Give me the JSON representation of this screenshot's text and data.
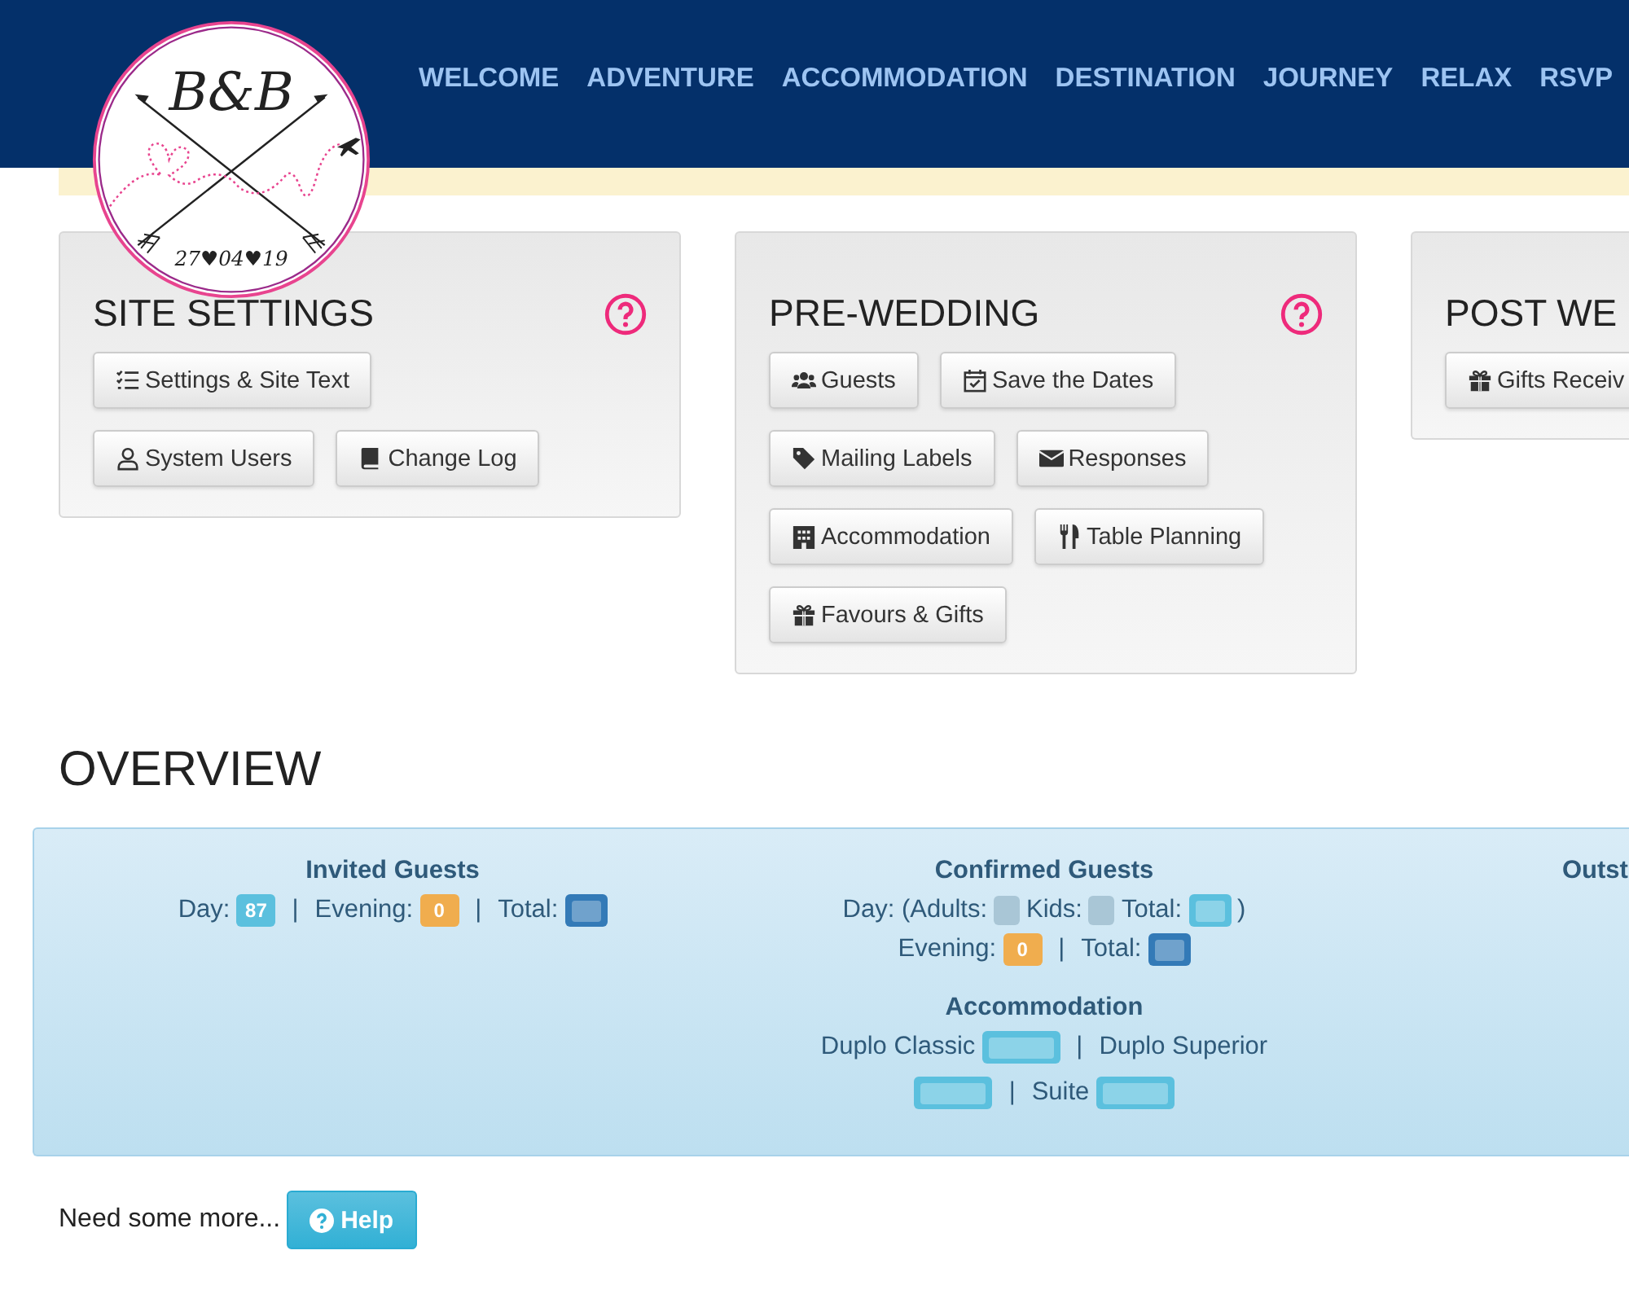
{
  "logo": {
    "monogram": "B&B",
    "date": "27♥04♥19"
  },
  "nav": [
    "WELCOME",
    "ADVENTURE",
    "ACCOMMODATION",
    "DESTINATION",
    "JOURNEY",
    "RELAX",
    "RSVP"
  ],
  "cards": [
    {
      "title": "SITE SETTINGS",
      "buttons": [
        "Settings & Site Text",
        "System Users",
        "Change Log"
      ]
    },
    {
      "title": "PRE-WEDDING",
      "buttons": [
        "Guests",
        "Save the Dates",
        "Mailing Labels",
        "Responses",
        "Accommodation",
        "Table Planning",
        "Favours & Gifts"
      ]
    },
    {
      "title": "POST WE",
      "buttons": [
        "Gifts Receiv"
      ]
    }
  ],
  "overview": {
    "title": "OVERVIEW",
    "columns": [
      {
        "sections": [
          {
            "title": "Invited Guests",
            "lines": [
              [
                {
                  "kind": "text",
                  "text": "Day:"
                },
                {
                  "kind": "badge",
                  "color": "#5bc0de",
                  "value": "87"
                },
                {
                  "kind": "sep",
                  "text": "|"
                },
                {
                  "kind": "text",
                  "text": "Evening:"
                },
                {
                  "kind": "badge",
                  "color": "#f0ad4e",
                  "value": "0"
                },
                {
                  "kind": "sep",
                  "text": "|"
                },
                {
                  "kind": "text",
                  "text": "Total:"
                },
                {
                  "kind": "badge",
                  "color": "#337ab7",
                  "redacted": true
                }
              ]
            ]
          }
        ]
      },
      {
        "sections": [
          {
            "title": "Confirmed Guests",
            "lines": [
              [
                {
                  "kind": "text",
                  "text": "Day: (Adults:"
                },
                {
                  "kind": "smudge"
                },
                {
                  "kind": "text",
                  "text": "Kids:"
                },
                {
                  "kind": "smudge"
                },
                {
                  "kind": "text",
                  "text": "Total:"
                },
                {
                  "kind": "badge",
                  "color": "#5bc0de",
                  "redacted": true
                },
                {
                  "kind": "text",
                  "text": ")"
                }
              ],
              [
                {
                  "kind": "text",
                  "text": "Evening:"
                },
                {
                  "kind": "badge",
                  "color": "#f0ad4e",
                  "value": "0"
                },
                {
                  "kind": "sep",
                  "text": "|"
                },
                {
                  "kind": "text",
                  "text": "Total:"
                },
                {
                  "kind": "badge",
                  "color": "#337ab7",
                  "redacted": true
                }
              ]
            ]
          },
          {
            "title": "Accommodation",
            "lines": [
              [
                {
                  "kind": "text",
                  "text": "Duplo Classic"
                },
                {
                  "kind": "badge",
                  "color": "#5bc0de",
                  "redacted": true,
                  "wide": true
                },
                {
                  "kind": "sep",
                  "text": "|"
                },
                {
                  "kind": "text",
                  "text": "Duplo Superior"
                },
                {
                  "kind": "badge",
                  "color": "#5bc0de",
                  "redacted": true,
                  "wide": true
                },
                {
                  "kind": "sep",
                  "text": "|"
                },
                {
                  "kind": "text",
                  "text": "Suite"
                },
                {
                  "kind": "badge",
                  "color": "#5bc0de",
                  "redacted": true,
                  "wide": true
                }
              ]
            ]
          }
        ]
      },
      {
        "sections": [
          {
            "title": "Outst"
          }
        ]
      }
    ]
  },
  "footer": {
    "text": "Need some more...",
    "button": "Help"
  }
}
